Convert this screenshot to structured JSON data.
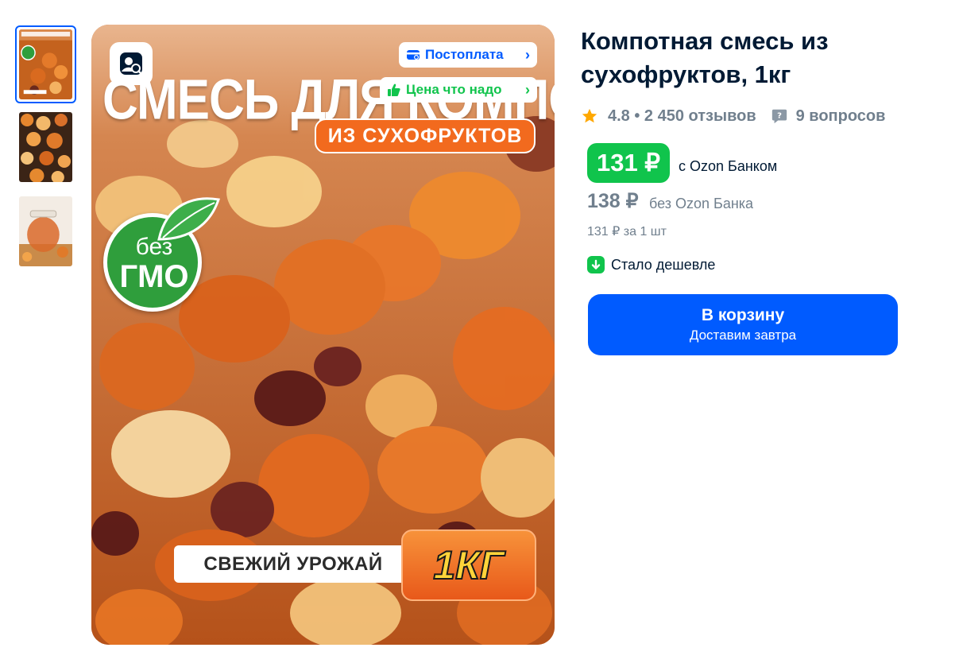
{
  "product": {
    "title": "Компотная смесь из сухофруктов, 1кг",
    "rating": "4.8",
    "reviews": "• 2 450 отзывов",
    "questions": "9 вопросов"
  },
  "image": {
    "title_text": "СМЕСЬ ДЛЯ КОМПОТА",
    "subtitle_badge": "ИЗ СУХОФРУКТОВ",
    "gmo_line1": "без",
    "gmo_line2": "ГМО",
    "fresh_label": "СВЕЖИЙ УРОЖАЙ",
    "weight_label": "1КГ"
  },
  "overlays": {
    "postoplata": "Постоплата",
    "fair_price": "Цена что надо"
  },
  "pricing": {
    "ozon_bank_price": "131 ₽",
    "ozon_bank_label": "с Ozon Банком",
    "regular_price": "138 ₽",
    "regular_label": "без Ozon Банка",
    "unit_price": "131 ₽ за 1 шт",
    "cheaper_label": "Стало дешевле"
  },
  "cart": {
    "button_label": "В корзину",
    "delivery_label": "Доставим завтра"
  },
  "colors": {
    "accent_blue": "#005bff",
    "accent_green": "#10c44c",
    "text_primary": "#001a34",
    "text_secondary": "#707f8d",
    "star": "#ffa800"
  },
  "icons": {
    "star": "star-icon",
    "question": "question-icon",
    "visual_search": "visual-search-icon",
    "postoplata": "wallet-icon",
    "fair_price": "thumbs-up-icon",
    "cheaper": "arrow-down-icon",
    "chevron": "chevron-right-icon"
  }
}
